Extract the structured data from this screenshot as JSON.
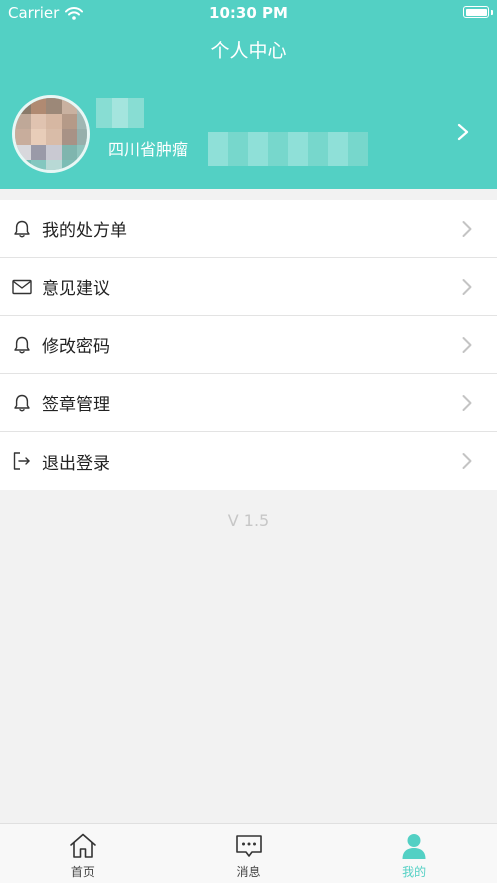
{
  "status_bar": {
    "carrier": "Carrier",
    "time": "10:30 PM"
  },
  "header": {
    "title": "个人中心"
  },
  "profile": {
    "hospital": "四川省肿瘤"
  },
  "menu": {
    "items": [
      {
        "label": "我的处方单",
        "icon": "bell-icon"
      },
      {
        "label": "意见建议",
        "icon": "envelope-icon"
      },
      {
        "label": "修改密码",
        "icon": "bell-icon"
      },
      {
        "label": "签章管理",
        "icon": "bell-icon"
      },
      {
        "label": "退出登录",
        "icon": "logout-icon"
      }
    ]
  },
  "version": "V 1.5",
  "tabbar": {
    "items": [
      {
        "label": "首页",
        "icon": "home-icon",
        "active": false
      },
      {
        "label": "消息",
        "icon": "message-icon",
        "active": false
      },
      {
        "label": "我的",
        "icon": "person-icon",
        "active": true
      }
    ]
  },
  "colors": {
    "accent": "#53d0c4",
    "background": "#f2f2f2",
    "chevron": "#c4c4c4"
  }
}
